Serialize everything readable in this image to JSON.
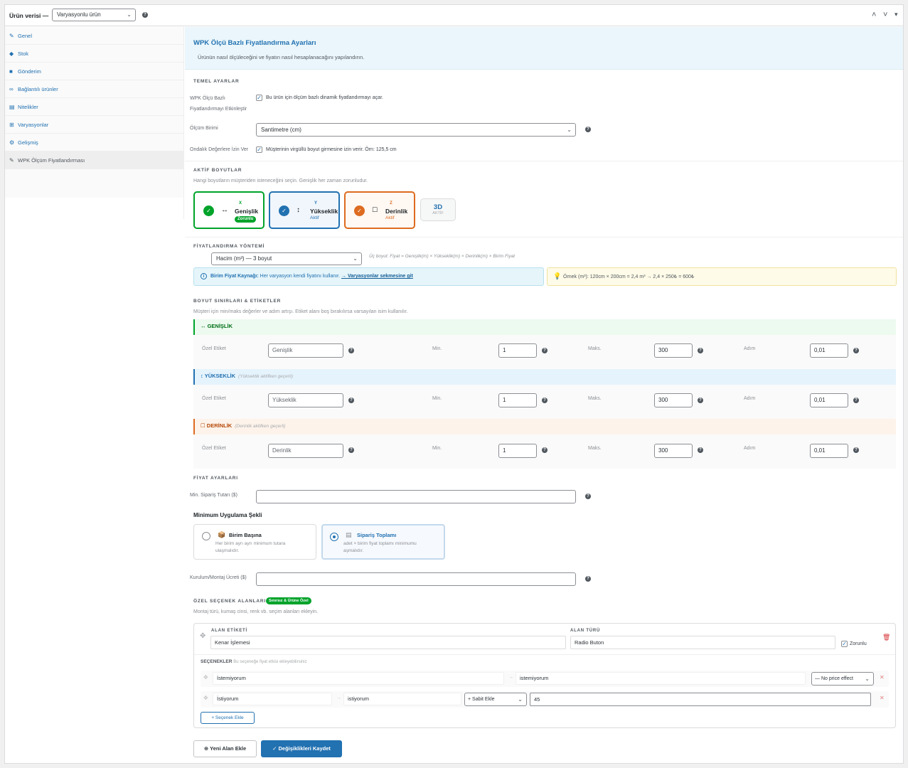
{
  "header": {
    "title": "Ürün verisi —",
    "product_type": "Varyasyonlu ürün",
    "up_icon": "˄",
    "down_icon": "˅",
    "toggle_icon": "▾"
  },
  "sidebar": {
    "items": [
      {
        "label": "Genel",
        "icon": "wrench-icon"
      },
      {
        "label": "Stok",
        "icon": "tag-icon"
      },
      {
        "label": "Gönderim",
        "icon": "truck-icon"
      },
      {
        "label": "Bağlantılı ürünler",
        "icon": "link-icon"
      },
      {
        "label": "Nitelikler",
        "icon": "list-icon"
      },
      {
        "label": "Varyasyonlar",
        "icon": "grid-icon"
      },
      {
        "label": "Gelişmiş",
        "icon": "gear-icon"
      },
      {
        "label": "WPK Ölçüm Fiyatlandırması",
        "icon": "wrench-icon"
      }
    ]
  },
  "banner": {
    "title": "WPK Ölçü Bazlı Fiyatlandırma Ayarları",
    "subtitle": "Ürünün nasıl ölçüleceğini ve fiyatın nasıl hesaplanacağını yapılandırın."
  },
  "basic": {
    "section": "TEMEL AYARLAR",
    "enable_label_1": "WPK Ölçü Bazlı",
    "enable_label_2": "Fiyatlandırmayı Etkinleştir",
    "enable_text": "Bu ürün için ölçüm bazlı dinamik fiyatlandırmayı açar.",
    "unit_label": "Ölçüm Birimi",
    "unit_value": "Santimetre (cm)",
    "decimal_label": "Ondalık Değerlere İzin Ver",
    "decimal_text": "Müşterinin virgüllü boyut girmesine izin verir. Örn: 125,5 cm"
  },
  "dimensions": {
    "section": "AKTİF BOYUTLAR",
    "desc": "Hangi boyutların müşteriden isteneceğini seçin. Genişlik her zaman zorunludur.",
    "width": {
      "letter": "X",
      "name": "Genişlik",
      "badge": "Zorunlu",
      "arrow": "↔"
    },
    "height": {
      "letter": "Y",
      "name": "Yükseklik",
      "status": "Aktif",
      "arrow": "↕"
    },
    "depth": {
      "letter": "Z",
      "name": "Derinlik",
      "status": "Aktif",
      "arrow": "☐"
    },
    "three_d": {
      "title": "3D",
      "status": "AKTİF"
    }
  },
  "pricing_method": {
    "section": "FİYATLANDIRMA YÖNTEMİ",
    "value": "Hacim (m³) — 3 boyut",
    "formula": "Üç boyut: Fiyat = Genişlik(m) × Yükseklik(m) × Derinlik(m) × Birim Fiyat",
    "info_bold": "Birim Fiyat Kaynağı:",
    "info_text": " Her varyasyon kendi fiyatını kullanır. ",
    "info_link": "→ Varyasyonlar sekmesine git",
    "example": "Örnek (m³): 120cm × 200cm = 2,4 m³ → 2,4 × 250₺ = 600₺"
  },
  "limits": {
    "section": "BOYUT SINIRLARI & ETİKETLER",
    "desc": "Müşteri için min/maks değerler ve adım artışı. Etiket alanı boş bırakılırsa varsayılan isim kullanılır.",
    "custom_label": "Özel Etiket",
    "min_label": "Min.",
    "max_label": "Maks.",
    "step_label": "Adım",
    "rows": [
      {
        "title": "↔ GENİŞLİK",
        "sub": "",
        "label_value": "Genişlik",
        "min": "1",
        "max": "300",
        "step": "0,01"
      },
      {
        "title": "↕ YÜKSEKLİK",
        "sub": "(Yükseklik aktifken geçerli)",
        "label_value": "Yükseklik",
        "min": "1",
        "max": "300",
        "step": "0,01"
      },
      {
        "title": "☐ DERİNLİK",
        "sub": "(Derinlik aktifken geçerli)",
        "label_value": "Derinlik",
        "min": "1",
        "max": "300",
        "step": "0,01"
      }
    ]
  },
  "price": {
    "section": "FİYAT AYARLARI",
    "min_order_label": "Min. Sipariş Tutarı ($)",
    "min_order_value": "",
    "apply_title": "Minimum Uygulama Şekli",
    "per_unit_title": "Birim Başına",
    "per_unit_desc_1": "Her birim ayrı ayrı minimum tutara",
    "per_unit_desc_2": "ulaşmalıdır.",
    "order_total_title": "Sipariş Toplamı",
    "order_total_desc_1": "adet × birim fiyat toplamı minimumu",
    "order_total_desc_2": "aşmalıdır.",
    "install_label": "Kurulum/Montaj Ücreti ($)",
    "install_value": ""
  },
  "custom": {
    "section": "ÖZEL SEÇENEK ALANLARI",
    "badge": "Sınırsız & Ürüne Özel",
    "desc": "Montaj türü, kumaş cinsi, renk vb. seçim alanları ekleyin.",
    "field_label_title": "ALAN ETİKETİ",
    "field_label_value": "Kenar İşlemesi",
    "field_type_title": "ALAN TÜRÜ",
    "field_type_value": "Radio Buton",
    "required": "Zorunlu",
    "options_title": "SEÇENEKLER",
    "options_hint": "Bu seçeneğe fiyat etkisi ekleyebilirsiniz",
    "opt1_label": "İstemiyorum",
    "opt1_value": "istemiyorum",
    "opt1_effect": "— No price effect",
    "opt2_label": "İstiyorum",
    "opt2_value": "istiyorum",
    "opt2_effect": "+ Sabit Ekle",
    "opt2_amount": "45",
    "add_option": "+ Seçenek Ekle"
  },
  "footer": {
    "new_field": "Yeni Alan Ekle",
    "save": "Değişiklikleri Kaydet"
  },
  "colors": {
    "accent": "#2271b1",
    "green": "#00a32a",
    "orange": "#dd6b20",
    "yellow_bg": "#fefbe8"
  }
}
